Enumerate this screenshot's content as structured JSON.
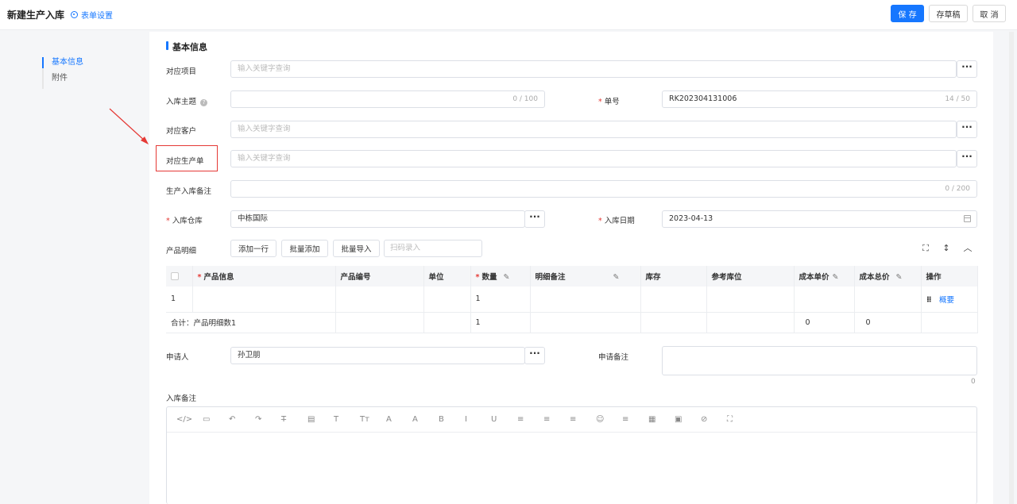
{
  "header": {
    "title": "新建生产入库",
    "form_settings": "表单设置",
    "save": "保 存",
    "draft": "存草稿",
    "cancel": "取 消"
  },
  "nav": {
    "basic": "基本信息",
    "attachment": "附件"
  },
  "section": {
    "title": "基本信息"
  },
  "fields": {
    "project": {
      "label": "对应项目",
      "placeholder": "输入关键字查询"
    },
    "subject": {
      "label": "入库主题",
      "count": "0 / 100"
    },
    "number": {
      "label": "单号",
      "value": "RK202304131006",
      "count": "14 / 50"
    },
    "customer": {
      "label": "对应客户",
      "placeholder": "输入关键字查询"
    },
    "order": {
      "label": "对应生产单",
      "placeholder": "输入关键字查询"
    },
    "remark": {
      "label": "生产入库备注",
      "count": "0 / 200"
    },
    "warehouse": {
      "label": "入库仓库",
      "value": "中栋国际"
    },
    "date": {
      "label": "入库日期",
      "value": "2023-04-13"
    },
    "applicant": {
      "label": "申请人",
      "value": "孙卫朋"
    },
    "apply_remark": {
      "label": "申请备注",
      "count": "0"
    },
    "in_remark": {
      "label": "入库备注"
    }
  },
  "product": {
    "label": "产品明细",
    "add_row": "添加一行",
    "batch_add": "批量添加",
    "batch_import": "批量导入",
    "scan_placeholder": "扫码录入",
    "columns": {
      "info": "产品信息",
      "code": "产品编号",
      "unit": "单位",
      "qty": "数量",
      "note": "明细备注",
      "stock": "库存",
      "location": "参考库位",
      "cost_price": "成本单价",
      "cost_total": "成本总价",
      "ops": "操作"
    },
    "row": {
      "index": "1",
      "qty": "1",
      "action": "概要"
    },
    "summary": {
      "label": "合计：产品明细数1",
      "qty": "1",
      "cost_price": "0",
      "cost_total": "0"
    }
  },
  "editor_tools": [
    "</>",
    "▭",
    "↶",
    "↷",
    "T̶",
    "▤",
    "T",
    "Tт",
    "A",
    "A",
    "B",
    "I",
    "U",
    "≡",
    "≡",
    "≡",
    "☺",
    "≡",
    "▦",
    "▣",
    "⊘",
    "⛶"
  ]
}
